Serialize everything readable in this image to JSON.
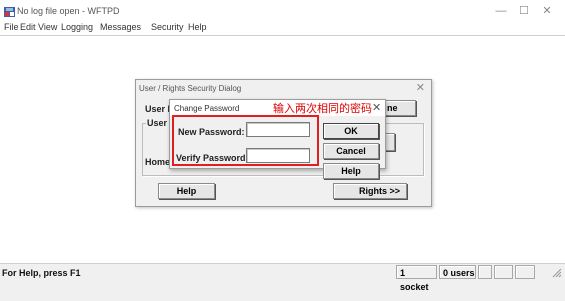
{
  "window": {
    "title": "No log file open - WFTPD",
    "controls": {
      "minimize": "—",
      "maximize": "☐",
      "close": "✕"
    }
  },
  "menu": [
    "File",
    "Edit",
    "View",
    "Logging",
    "Messages",
    "Security",
    "Help"
  ],
  "status": {
    "help_text": "For Help, press F1",
    "sockets": "1 socket",
    "users": "0 users"
  },
  "security_dialog": {
    "title": "User / Rights Security Dialog",
    "close": "✕",
    "user_name_label": "User Na",
    "user_group_label": "User ...",
    "home_label": "Home D",
    "partial_button": "ne",
    "help_button": "Help",
    "rights_button": "Rights >>"
  },
  "change_password_dialog": {
    "title": "Change Password",
    "close": "✕",
    "annotation": "输入两次相同的密码",
    "new_password_label": "New Password:",
    "verify_password_label": "Verify Password:",
    "new_password_value": "",
    "verify_password_value": "",
    "ok_button": "OK",
    "cancel_button": "Cancel",
    "help_button": "Help"
  },
  "colors": {
    "annotation": "#e00000",
    "highlight_box": "#e02020",
    "dialog_bg": "#f0f0f0"
  }
}
